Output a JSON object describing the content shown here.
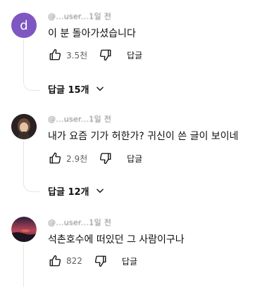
{
  "comments": [
    {
      "author": "@...user...1일 전",
      "avatar_letter": "d",
      "avatar_color": "#7e57c2",
      "text": "이 분 돌아가셨습니다",
      "likes": "3.5천",
      "reply_label": "답글",
      "replies_label": "답글 15개"
    },
    {
      "author": "@...user...1일 전",
      "text": "내가 요즘 기가 허한가? 귀신이 쓴 글이 보이네",
      "likes": "2.9천",
      "reply_label": "답글",
      "replies_label": "답글 12개"
    },
    {
      "author": "@...user...1일 전",
      "text": "석촌호수에 떠있던 그 사람이구나",
      "likes": "822",
      "reply_label": "답글"
    }
  ],
  "icons": {
    "like": "thumbs-up-icon",
    "dislike": "thumbs-down-icon",
    "expand": "chevron-down-icon"
  }
}
